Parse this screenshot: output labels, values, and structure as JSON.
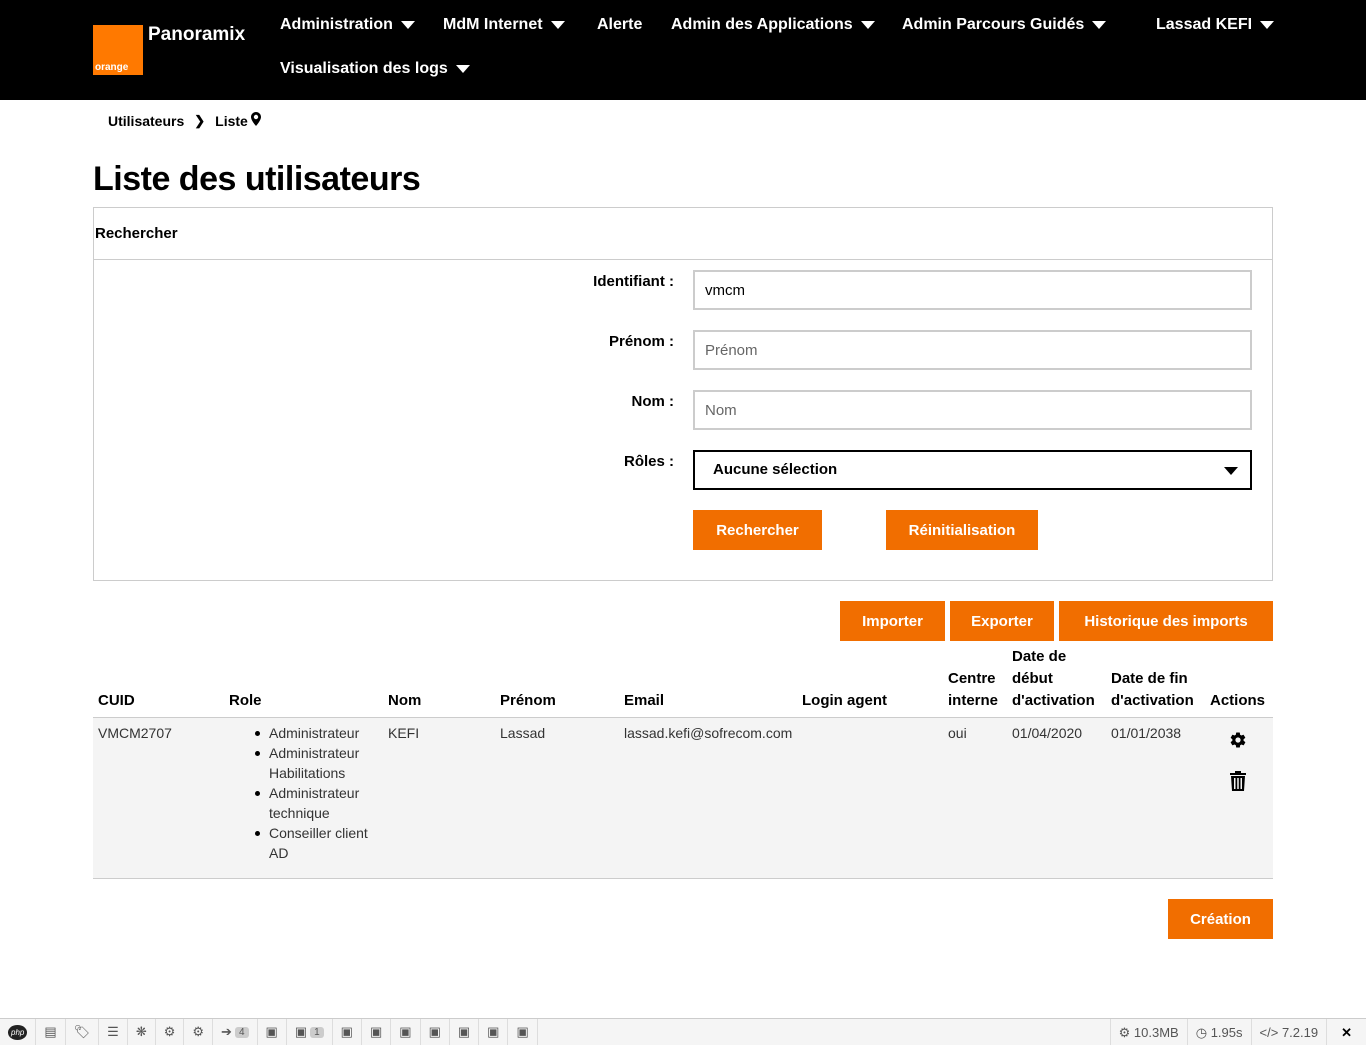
{
  "header": {
    "brand": "Panoramix",
    "logo_text": "orange",
    "nav": [
      {
        "label": "Administration"
      },
      {
        "label": "MdM Internet"
      },
      {
        "label": "Alerte"
      },
      {
        "label": "Admin des Applications"
      },
      {
        "label": "Admin Parcours Guidés"
      },
      {
        "label": "Visualisation des logs"
      }
    ],
    "user": "Lassad KEFI"
  },
  "breadcrumb": {
    "first": "Utilisateurs",
    "second": "Liste"
  },
  "page_title": "Liste des utilisateurs",
  "search": {
    "title": "Rechercher",
    "identifiant_label": "Identifiant :",
    "identifiant_value": "vmcm",
    "prenom_label": "Prénom :",
    "prenom_placeholder": "Prénom",
    "nom_label": "Nom :",
    "nom_placeholder": "Nom",
    "roles_label": "Rôles :",
    "roles_selected": "Aucune sélection",
    "search_button": "Rechercher",
    "reset_button": "Réinitialisation"
  },
  "actions": {
    "import": "Importer",
    "export": "Exporter",
    "history": "Historique des imports",
    "create": "Création"
  },
  "table": {
    "columns": {
      "cuid": "CUID",
      "role": "Role",
      "nom": "Nom",
      "prenom": "Prénom",
      "email": "Email",
      "login": "Login agent",
      "centre_l1": "Centre",
      "centre_l2": "interne",
      "debut_l1": "Date de",
      "debut_l2": "début",
      "debut_l3": "d'activation",
      "fin_l1": "Date de fin",
      "fin_l2": "d'activation",
      "actions": "Actions"
    },
    "rows": [
      {
        "cuid": "VMCM2707",
        "roles": [
          "Administrateur",
          "Administrateur Habilitations",
          "Administrateur technique",
          "Conseiller client AD"
        ],
        "nom": "KEFI",
        "prenom": "Lassad",
        "email": "lassad.kefi@sofrecom.com",
        "login": "",
        "centre": "oui",
        "debut": "01/04/2020",
        "fin": "01/01/2038"
      }
    ]
  },
  "debugbar": {
    "php_label": "php",
    "badge_1": "4",
    "badge_2": "1",
    "memory": "10.3MB",
    "time": "1.95s",
    "version": "7.2.19"
  },
  "colors": {
    "accent": "#f16e00",
    "header_bg": "#000000"
  }
}
